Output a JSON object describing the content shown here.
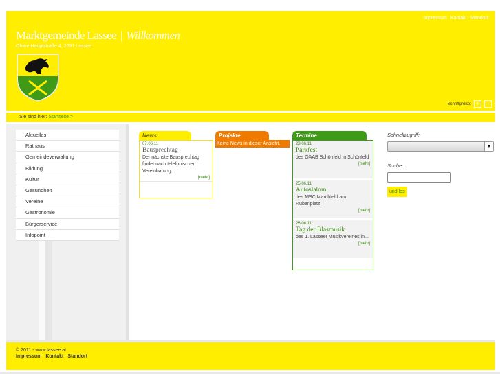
{
  "header": {
    "top_links": [
      "Impressum",
      "Kontakt",
      "Standort"
    ],
    "title_main": "Marktgemeinde Lassee",
    "title_sep": "|",
    "title_em": "Willkommen",
    "address": "Obere Hauptstraße 4, 2291 Lassee",
    "fontsize_label": "Schriftgröße:",
    "fontsize_plus": "+",
    "fontsize_minus": "-",
    "colors": {
      "accent": "#ffee00",
      "green": "#3f9a18",
      "orange": "#ee7a00"
    }
  },
  "breadcrumb": {
    "prefix": "Sie sind hier:",
    "link": "Startseite",
    "suffix": ">"
  },
  "nav": [
    "Aktuelles",
    "Rathaus",
    "Gemeindeverwaltung",
    "Bildung",
    "Kultur",
    "Gesundheit",
    "Vereine",
    "Gastronomie",
    "Bürgerservice",
    "Infopoint"
  ],
  "news": {
    "tab": "News",
    "items": [
      {
        "date": "07.06.11",
        "title": "Bausprechtag",
        "text": "Der nächste Bausprechtag findet nach telefonischer Vereinbarung...",
        "more": "[mehr]"
      }
    ]
  },
  "projekte": {
    "tab": "Projekte",
    "empty": "Keine News in dieser Ansicht."
  },
  "termine": {
    "tab": "Termine",
    "items": [
      {
        "date": "23.06.11",
        "title": "Parkfest",
        "text": "des ÖAAB Schönfeld in Schönfeld",
        "more": "[mehr]"
      },
      {
        "date": "25.06.11",
        "title": "Autoslalom",
        "text": "des MSC Marchfeld am Rübenplatz",
        "more": "[mehr]"
      },
      {
        "date": "26.06.11",
        "title": "Tag der Blasmusik",
        "text": "des 1. Lasseer Musikvereines in...",
        "more": "[mehr]"
      }
    ]
  },
  "right": {
    "quick_label": "Schnellzugriff:",
    "quick_value": "",
    "search_label": "Suche:",
    "search_value": "",
    "go_label": "und los"
  },
  "footer": {
    "copyright": "© 2011 - www.lassee.at",
    "links": [
      "Impressum",
      "Kontakt",
      "Standort"
    ]
  }
}
